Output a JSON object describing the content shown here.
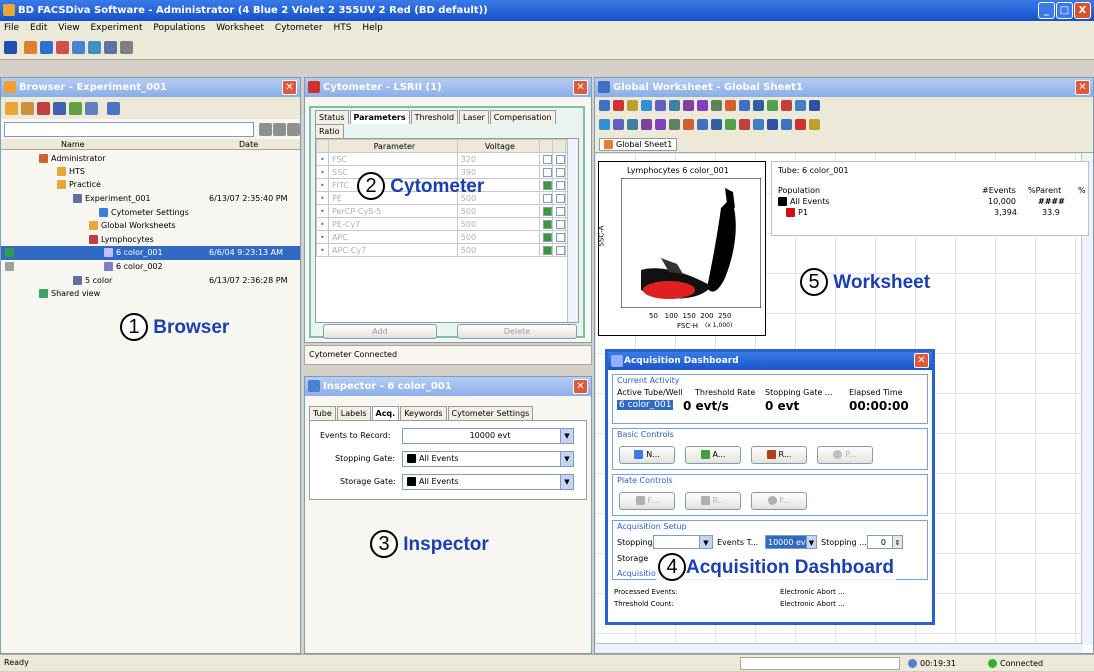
{
  "app": {
    "title": "BD FACSDiva Software - Administrator (4 Blue 2 Violet 2 355UV 2 Red (BD default))",
    "minimize": "_",
    "maximize": "□",
    "close": "X"
  },
  "menu": [
    "File",
    "Edit",
    "View",
    "Experiment",
    "Populations",
    "Worksheet",
    "Cytometer",
    "HTS",
    "Help"
  ],
  "browser": {
    "title": "Browser - Experiment_001",
    "columns": {
      "name": "Name",
      "date": "Date"
    },
    "tree": [
      {
        "label": "Administrator",
        "date": ""
      },
      {
        "label": "HTS",
        "date": ""
      },
      {
        "label": "Practice",
        "date": ""
      },
      {
        "label": "Experiment_001",
        "date": "6/13/07 2:35:40 PM"
      },
      {
        "label": "Cytometer Settings",
        "date": ""
      },
      {
        "label": "Global Worksheets",
        "date": ""
      },
      {
        "label": "Lymphocytes",
        "date": ""
      },
      {
        "label": "6 color_001",
        "date": "6/6/04 9:23:13 AM"
      },
      {
        "label": "6 color_002",
        "date": ""
      },
      {
        "label": "5 color",
        "date": "6/13/07 2:36:28 PM"
      },
      {
        "label": "Shared view",
        "date": ""
      }
    ],
    "callout_num": "1",
    "callout": "Browser"
  },
  "cytometer": {
    "title": "Cytometer - LSRII (1)",
    "tabs": [
      "Status",
      "Parameters",
      "Threshold",
      "Laser",
      "Compensation",
      "Ratio"
    ],
    "columns": {
      "parameter": "Parameter",
      "voltage": "Voltage"
    },
    "rows": [
      {
        "p": "FSC",
        "v": "320"
      },
      {
        "p": "SSC",
        "v": "390"
      },
      {
        "p": "FITC",
        "v": "500"
      },
      {
        "p": "PE",
        "v": "500"
      },
      {
        "p": "PerCP-Cy5-5",
        "v": "500"
      },
      {
        "p": "PE-Cy7",
        "v": "500"
      },
      {
        "p": "APC",
        "v": "500"
      },
      {
        "p": "APC-Cy7",
        "v": "500"
      }
    ],
    "add": "Add",
    "delete": "Delete",
    "status": "Cytometer Connected",
    "callout_num": "2",
    "callout": "Cytometer"
  },
  "inspector": {
    "title": "Inspector - 6 color_001",
    "tabs": [
      "Tube",
      "Labels",
      "Acq.",
      "Keywords",
      "Cytometer Settings"
    ],
    "events_label": "Events to Record:",
    "events_value": "10000 evt",
    "stopping_label": "Stopping Gate:",
    "stopping_value": "All Events",
    "storage_label": "Storage Gate:",
    "storage_value": "All Events",
    "callout_num": "3",
    "callout": "Inspector"
  },
  "worksheet": {
    "title": "Global Worksheet - Global Sheet1",
    "tab": "Global Sheet1",
    "plot_title": "Lymphocytes 6 color_001",
    "y_axis": "SSC-A",
    "x_axis": "FSC-H",
    "x_ticks": [
      "50",
      "100",
      "150",
      "200",
      "250"
    ],
    "x_unit": "(x 1,000)",
    "tube": "Tube:  6 color_001",
    "stats_cols": [
      "Population",
      "#Events",
      "%Parent",
      "%"
    ],
    "stats_rows": [
      {
        "pop": "All Events",
        "events": "10,000",
        "parent": "####",
        "color": "#000000"
      },
      {
        "pop": "P1",
        "events": "3,394",
        "parent": "33.9",
        "color": "#d01010"
      }
    ],
    "callout_num": "5",
    "callout": "Worksheet"
  },
  "dashboard": {
    "title": "Acquisition Dashboard",
    "current_activity": "Current Activity",
    "headers": [
      "Active Tube/Well",
      "Threshold Rate",
      "Stopping Gate ...",
      "Elapsed Time"
    ],
    "tube": "6 color_001",
    "rate": "0 evt/s",
    "stop_evt": "0 evt",
    "elapsed": "00:00:00",
    "basic_controls": "Basic Controls",
    "basic_buttons": [
      "N...",
      "A...",
      "R...",
      "P..."
    ],
    "plate_controls": "Plate Controls",
    "plate_buttons": [
      "F...",
      "R...",
      "F..."
    ],
    "setup": "Acquisition Setup",
    "stopping_label": "Stopping",
    "events_label": "Events T...",
    "events_value": "10000 evt",
    "stopping_time_label": "Stopping ...",
    "stopping_time_value": "0",
    "storage_label": "Storage",
    "acq_label": "Acquisition",
    "processed": "Processed Events:",
    "threshold_count": "Threshold Count:",
    "abort1": "Electronic Abort ...",
    "abort2": "Electronic Abort ...",
    "callout_num": "4",
    "callout": "Acquisition Dashboard"
  },
  "statusbar": {
    "left": "Ready",
    "time": "00:19:31",
    "connection": "Connected"
  },
  "colors": {
    "accent": "#1a3fb0",
    "highlight": "#316ac5",
    "events_red": "#e02020"
  }
}
